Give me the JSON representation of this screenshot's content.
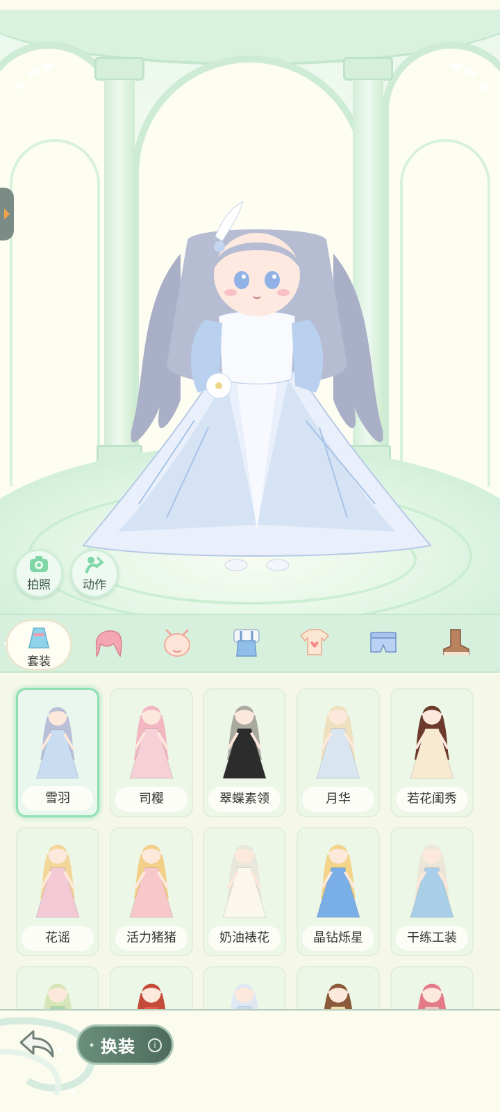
{
  "stage": {
    "photo_button_label": "拍照",
    "action_button_label": "动作"
  },
  "categories": {
    "active_label": "套装",
    "icons": [
      "outfit-icon",
      "hair-icon",
      "face-icon",
      "dress-icon",
      "top-icon",
      "bottom-icon",
      "shoes-icon"
    ]
  },
  "outfits": [
    {
      "name": "雪羽",
      "selected": true,
      "hair": "#b9bfd6",
      "dress": "#c8dcf2"
    },
    {
      "name": "司樱",
      "selected": false,
      "hair": "#f2b7c3",
      "dress": "#f6d0d6"
    },
    {
      "name": "翠蝶素领",
      "selected": false,
      "hair": "#a9a9a0",
      "dress": "#2c2c2c"
    },
    {
      "name": "月华",
      "selected": false,
      "hair": "#efe0c0",
      "dress": "#d9e6ef"
    },
    {
      "name": "若花闺秀",
      "selected": false,
      "hair": "#6b3a2a",
      "dress": "#f7ead0"
    },
    {
      "name": "花谣",
      "selected": false,
      "hair": "#f3d79a",
      "dress": "#f4c9d6"
    },
    {
      "name": "活力猪猪",
      "selected": false,
      "hair": "#f2d08a",
      "dress": "#f8c8c8"
    },
    {
      "name": "奶油裱花",
      "selected": false,
      "hair": "#e9e6dc",
      "dress": "#fbf7ee"
    },
    {
      "name": "晶钻烁星",
      "selected": false,
      "hair": "#f3d48a",
      "dress": "#7aaee6"
    },
    {
      "name": "干练工装",
      "selected": false,
      "hair": "#ece6d8",
      "dress": "#a9cfe8"
    },
    {
      "name": "",
      "selected": false,
      "hair": "#d6e6b8",
      "dress": "#a8d8b0"
    },
    {
      "name": "",
      "selected": false,
      "hair": "#c44a3a",
      "dress": "#e85a4a"
    },
    {
      "name": "",
      "selected": false,
      "hair": "#dfe8f2",
      "dress": "#c8dcf0"
    },
    {
      "name": "",
      "selected": false,
      "hair": "#8a5a3a",
      "dress": "#f2e2a8"
    },
    {
      "name": "",
      "selected": false,
      "hair": "#e37a86",
      "dress": "#f6c7c7"
    }
  ],
  "bottom": {
    "change_label": "换装",
    "info_glyph": "i"
  },
  "colors": {
    "accent_green": "#8ee0b2",
    "button_dark": "#4d6b5d"
  }
}
